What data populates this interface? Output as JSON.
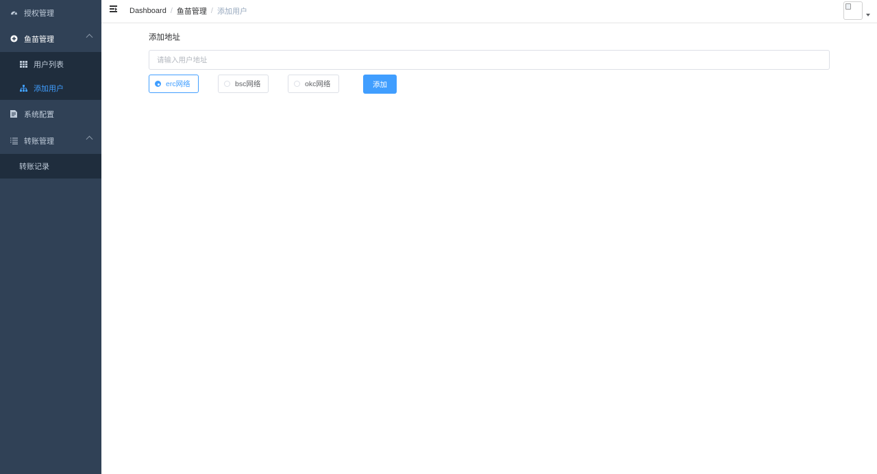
{
  "sidebar": {
    "items": [
      {
        "label": "授权管理",
        "icon": "dashboard-icon"
      },
      {
        "label": "鱼苗管理",
        "icon": "plus-circle-icon",
        "expanded": true,
        "children": [
          {
            "label": "用户列表",
            "icon": "table-icon"
          },
          {
            "label": "添加用户",
            "icon": "tree-icon",
            "active": true
          }
        ]
      },
      {
        "label": "系统配置",
        "icon": "form-icon"
      },
      {
        "label": "转账管理",
        "icon": "list-icon",
        "expanded": true,
        "children": [
          {
            "label": "转账记录"
          }
        ]
      }
    ]
  },
  "navbar": {
    "breadcrumb": [
      "Dashboard",
      "鱼苗管理",
      "添加用户"
    ],
    "separator": "/"
  },
  "form": {
    "title": "添加地址",
    "address_placeholder": "请输入用户地址",
    "address_value": "",
    "networks": [
      {
        "label": "erc网络",
        "checked": true
      },
      {
        "label": "bsc网络",
        "checked": false
      },
      {
        "label": "okc网络",
        "checked": false
      }
    ],
    "submit_label": "添加"
  },
  "colors": {
    "sidebar_bg": "#304156",
    "submenu_bg": "#1f2d3d",
    "sidebar_text": "#bfcbd9",
    "accent": "#409eff"
  }
}
